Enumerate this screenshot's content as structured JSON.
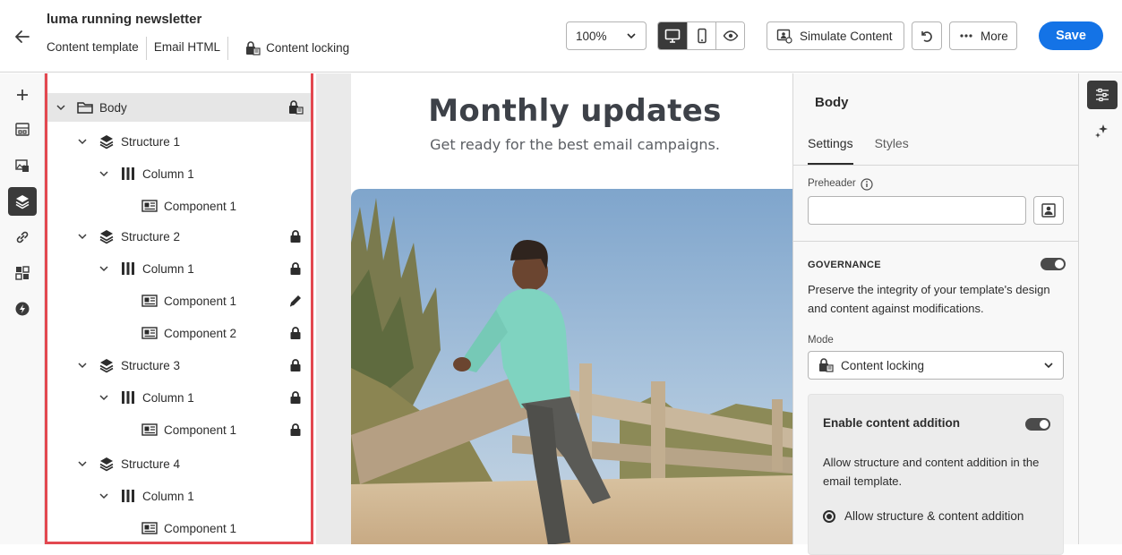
{
  "header": {
    "title": "luma running newsletter",
    "subnav": [
      "Content template",
      "Email HTML"
    ],
    "content_locking_label": "Content locking",
    "zoom": "100%",
    "simulate_label": "Simulate Content",
    "more_label": "More",
    "save_label": "Save"
  },
  "left_rail": {
    "icons": [
      "plus-icon",
      "structures-icon",
      "assets-icon",
      "layers-icon",
      "link-icon",
      "fragments-icon",
      "dynamic-content-icon"
    ],
    "active": "layers-icon"
  },
  "tree": {
    "rows": [
      {
        "label": "Body",
        "type": "body",
        "depth": 0,
        "right": "content-lock-icon",
        "selected": true
      },
      {
        "label": "Structure 1",
        "type": "structure",
        "depth": 1,
        "right": ""
      },
      {
        "label": "Column 1",
        "type": "column",
        "depth": 2,
        "right": ""
      },
      {
        "label": "Component 1",
        "type": "component",
        "depth": 3,
        "right": ""
      },
      {
        "label": "Structure 2",
        "type": "structure",
        "depth": 1,
        "right": "lock-icon"
      },
      {
        "label": "Column 1",
        "type": "column",
        "depth": 2,
        "right": "lock-icon"
      },
      {
        "label": "Component 1",
        "type": "component",
        "depth": 3,
        "right": "pencil-icon"
      },
      {
        "label": "Component 2",
        "type": "component",
        "depth": 3,
        "right": "lock-icon"
      },
      {
        "label": "Structure 3",
        "type": "structure",
        "depth": 1,
        "right": "lock-icon"
      },
      {
        "label": "Column 1",
        "type": "column",
        "depth": 2,
        "right": "lock-icon"
      },
      {
        "label": "Component 1",
        "type": "component",
        "depth": 3,
        "right": "lock-icon"
      },
      {
        "label": "Structure 4",
        "type": "structure",
        "depth": 1,
        "right": ""
      },
      {
        "label": "Column 1",
        "type": "column",
        "depth": 2,
        "right": ""
      },
      {
        "label": "Component 1",
        "type": "component",
        "depth": 3,
        "right": ""
      }
    ]
  },
  "email": {
    "title": "Monthly updates",
    "subtitle": "Get ready for the best email campaigns."
  },
  "panel": {
    "title": "Body",
    "tabs": [
      "Settings",
      "Styles"
    ],
    "active_tab": "Settings",
    "preheader_label": "Preheader",
    "preheader_value": "",
    "governance_heading": "GOVERNANCE",
    "governance_on": true,
    "governance_desc": "Preserve the integrity of your template's design and content against modifications.",
    "mode_label": "Mode",
    "mode_value": "Content locking",
    "addition_title": "Enable content addition",
    "addition_on": true,
    "addition_desc": "Allow structure and content addition in the email template.",
    "radio_label": "Allow structure & content addition"
  },
  "colors": {
    "accent": "#1473e6",
    "highlight_border": "#e34850",
    "selected_row": "#e6e6e6"
  }
}
